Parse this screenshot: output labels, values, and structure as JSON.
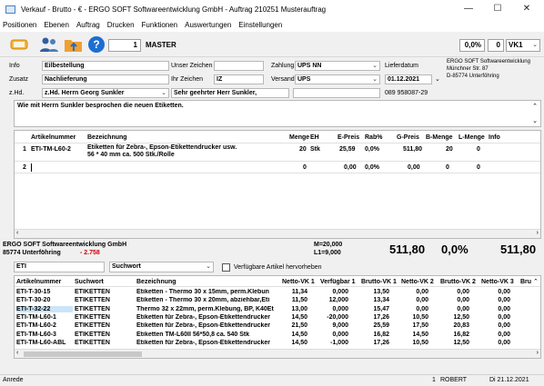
{
  "window": {
    "title": "Verkauf - Brutto - € - ERGO SOFT Softwareentwicklung GmbH - Auftrag 210251 Musterauftrag",
    "controls": [
      "—",
      "☐",
      "✕"
    ]
  },
  "menu": [
    "Positionen",
    "Ebenen",
    "Auftrag",
    "Drucken",
    "Funktionen",
    "Auswertungen",
    "Einstellungen"
  ],
  "toolbar": {
    "counter": "1",
    "master_label": "MASTER",
    "discount": "0,0%",
    "zero": "0",
    "price_group": "VK1"
  },
  "header": {
    "info_label": "Info",
    "info_value": "Eilbestellung",
    "zusatz_label": "Zusatz",
    "zusatz_value": "Nachlieferung",
    "zhd_label": "z.Hd.",
    "zhd_value": "z.Hd. Herrn Georg Sunkler",
    "salutation": "Sehr geehrter Herr Sunkler,",
    "unser_zeichen_label": "Unser Zeichen",
    "unser_zeichen_value": "",
    "ihr_zeichen_label": "Ihr Zeichen",
    "ihr_zeichen_value": "IZ",
    "zahlung_label": "Zahlung",
    "zahlung_value": "UPS NN",
    "versand_label": "Versand",
    "versand_value": "UPS",
    "lieferdatum_label": "Lieferdatum",
    "lieferdatum_value": "01.12.2021",
    "address_line1": "ERGO SOFT Softwareentwicklung",
    "address_line2": "Münchner Str. 87",
    "address_line3": "D-85774 Unterföhring",
    "phone": "089 958087-29"
  },
  "memo": "Wie mit Herrn Sunkler besprochen die neuen Etiketten.",
  "positions": {
    "columns": [
      "Artikelnummer",
      "Bezeichnung",
      "Menge",
      "EH",
      "E-Preis",
      "Rab%",
      "G-Preis",
      "B-Menge",
      "L-Menge",
      "Info"
    ],
    "rows": [
      {
        "nr": "1",
        "artikel": "ETI-TM-L60-2",
        "bez1": "Etiketten für Zebra-, Epson-Etikettendrucker usw.",
        "bez2": "56 * 40 mm ca. 500 Stk./Rolle",
        "menge": "20",
        "eh": "Stk",
        "epreis": "25,59",
        "rab": "0,0%",
        "gpreis": "511,80",
        "bmenge": "20",
        "lmenge": "0"
      },
      {
        "nr": "2",
        "artikel": "",
        "bez1": "",
        "bez2": "",
        "menge": "0",
        "eh": "",
        "epreis": "0,00",
        "rab": "0,0%",
        "gpreis": "0,00",
        "bmenge": "0",
        "lmenge": "0"
      }
    ]
  },
  "summary": {
    "company": "ERGO SOFT Softwareentwicklung GmbH",
    "city": "85774 Unterföhring",
    "balance": "- 2.758",
    "m_value": "M=20,000",
    "l_value": "L1=9,000",
    "total1": "511,80",
    "percent": "0,0%",
    "total2": "511,80"
  },
  "search": {
    "query": "ETI",
    "mode": "Suchwort",
    "checkbox_label": "Verfügbare Artikel hervorheben",
    "columns": [
      "Artikelnummer",
      "Suchwort",
      "Bezeichnung",
      "Netto-VK 1",
      "Verfügbar 1",
      "Brutto-VK 1",
      "Netto-VK 2",
      "Brutto-VK 2",
      "Netto-VK 3",
      "Bru"
    ],
    "rows": [
      [
        "ETI-T-30-15",
        "ETIKETTEN",
        "Etiketten - Thermo 30 x 15mm, perm.Klebun",
        "11,34",
        "0,000",
        "13,50",
        "0,00",
        "0,00",
        "0,00"
      ],
      [
        "ETI-T-30-20",
        "ETIKETTEN",
        "Etiketten - Thermo 30 x 20mm, abziehbar,Eti",
        "11,50",
        "12,000",
        "13,34",
        "0,00",
        "0,00",
        "0,00"
      ],
      [
        "ETI-T-32-22",
        "ETIKETTEN",
        "Thermo 32 x 22mm, perm.Klebung, BP, K40Et",
        "13,00",
        "0,000",
        "15,47",
        "0,00",
        "0,00",
        "0,00"
      ],
      [
        "ETI-TM-L60-1",
        "ETIKETTEN",
        "Etiketten für Zebra-, Epson-Etikettendrucker",
        "14,50",
        "-20,000",
        "17,26",
        "10,50",
        "12,50",
        "0,00"
      ],
      [
        "ETI-TM-L60-2",
        "ETIKETTEN",
        "Etiketten für Zebra-, Epson-Etikettendrucker",
        "21,50",
        "9,000",
        "25,59",
        "17,50",
        "20,83",
        "0,00"
      ],
      [
        "ETI-TM-L60-3",
        "ETIKETTEN",
        "Etiketten TM-L60II 56*50,8 ca. 540 Stk",
        "14,50",
        "0,000",
        "16,82",
        "14,50",
        "16,82",
        "0,00"
      ],
      [
        "ETI-TM-L60-ABL",
        "ETIKETTEN",
        "Etiketten für Zebra-, Epson-Etikettendrucker",
        "14,50",
        "-1,000",
        "17,26",
        "10,50",
        "12,50",
        "0,00"
      ]
    ]
  },
  "status": {
    "mode": "Anrede",
    "count": "1",
    "user": "ROBERT",
    "date": "Di 21.12.2021"
  },
  "colors": {
    "accent_blue": "#1c6fd1",
    "selected_cell": "#cce4f7",
    "negative_red": "#d00000",
    "toolbar_orange": "#f0a030"
  }
}
